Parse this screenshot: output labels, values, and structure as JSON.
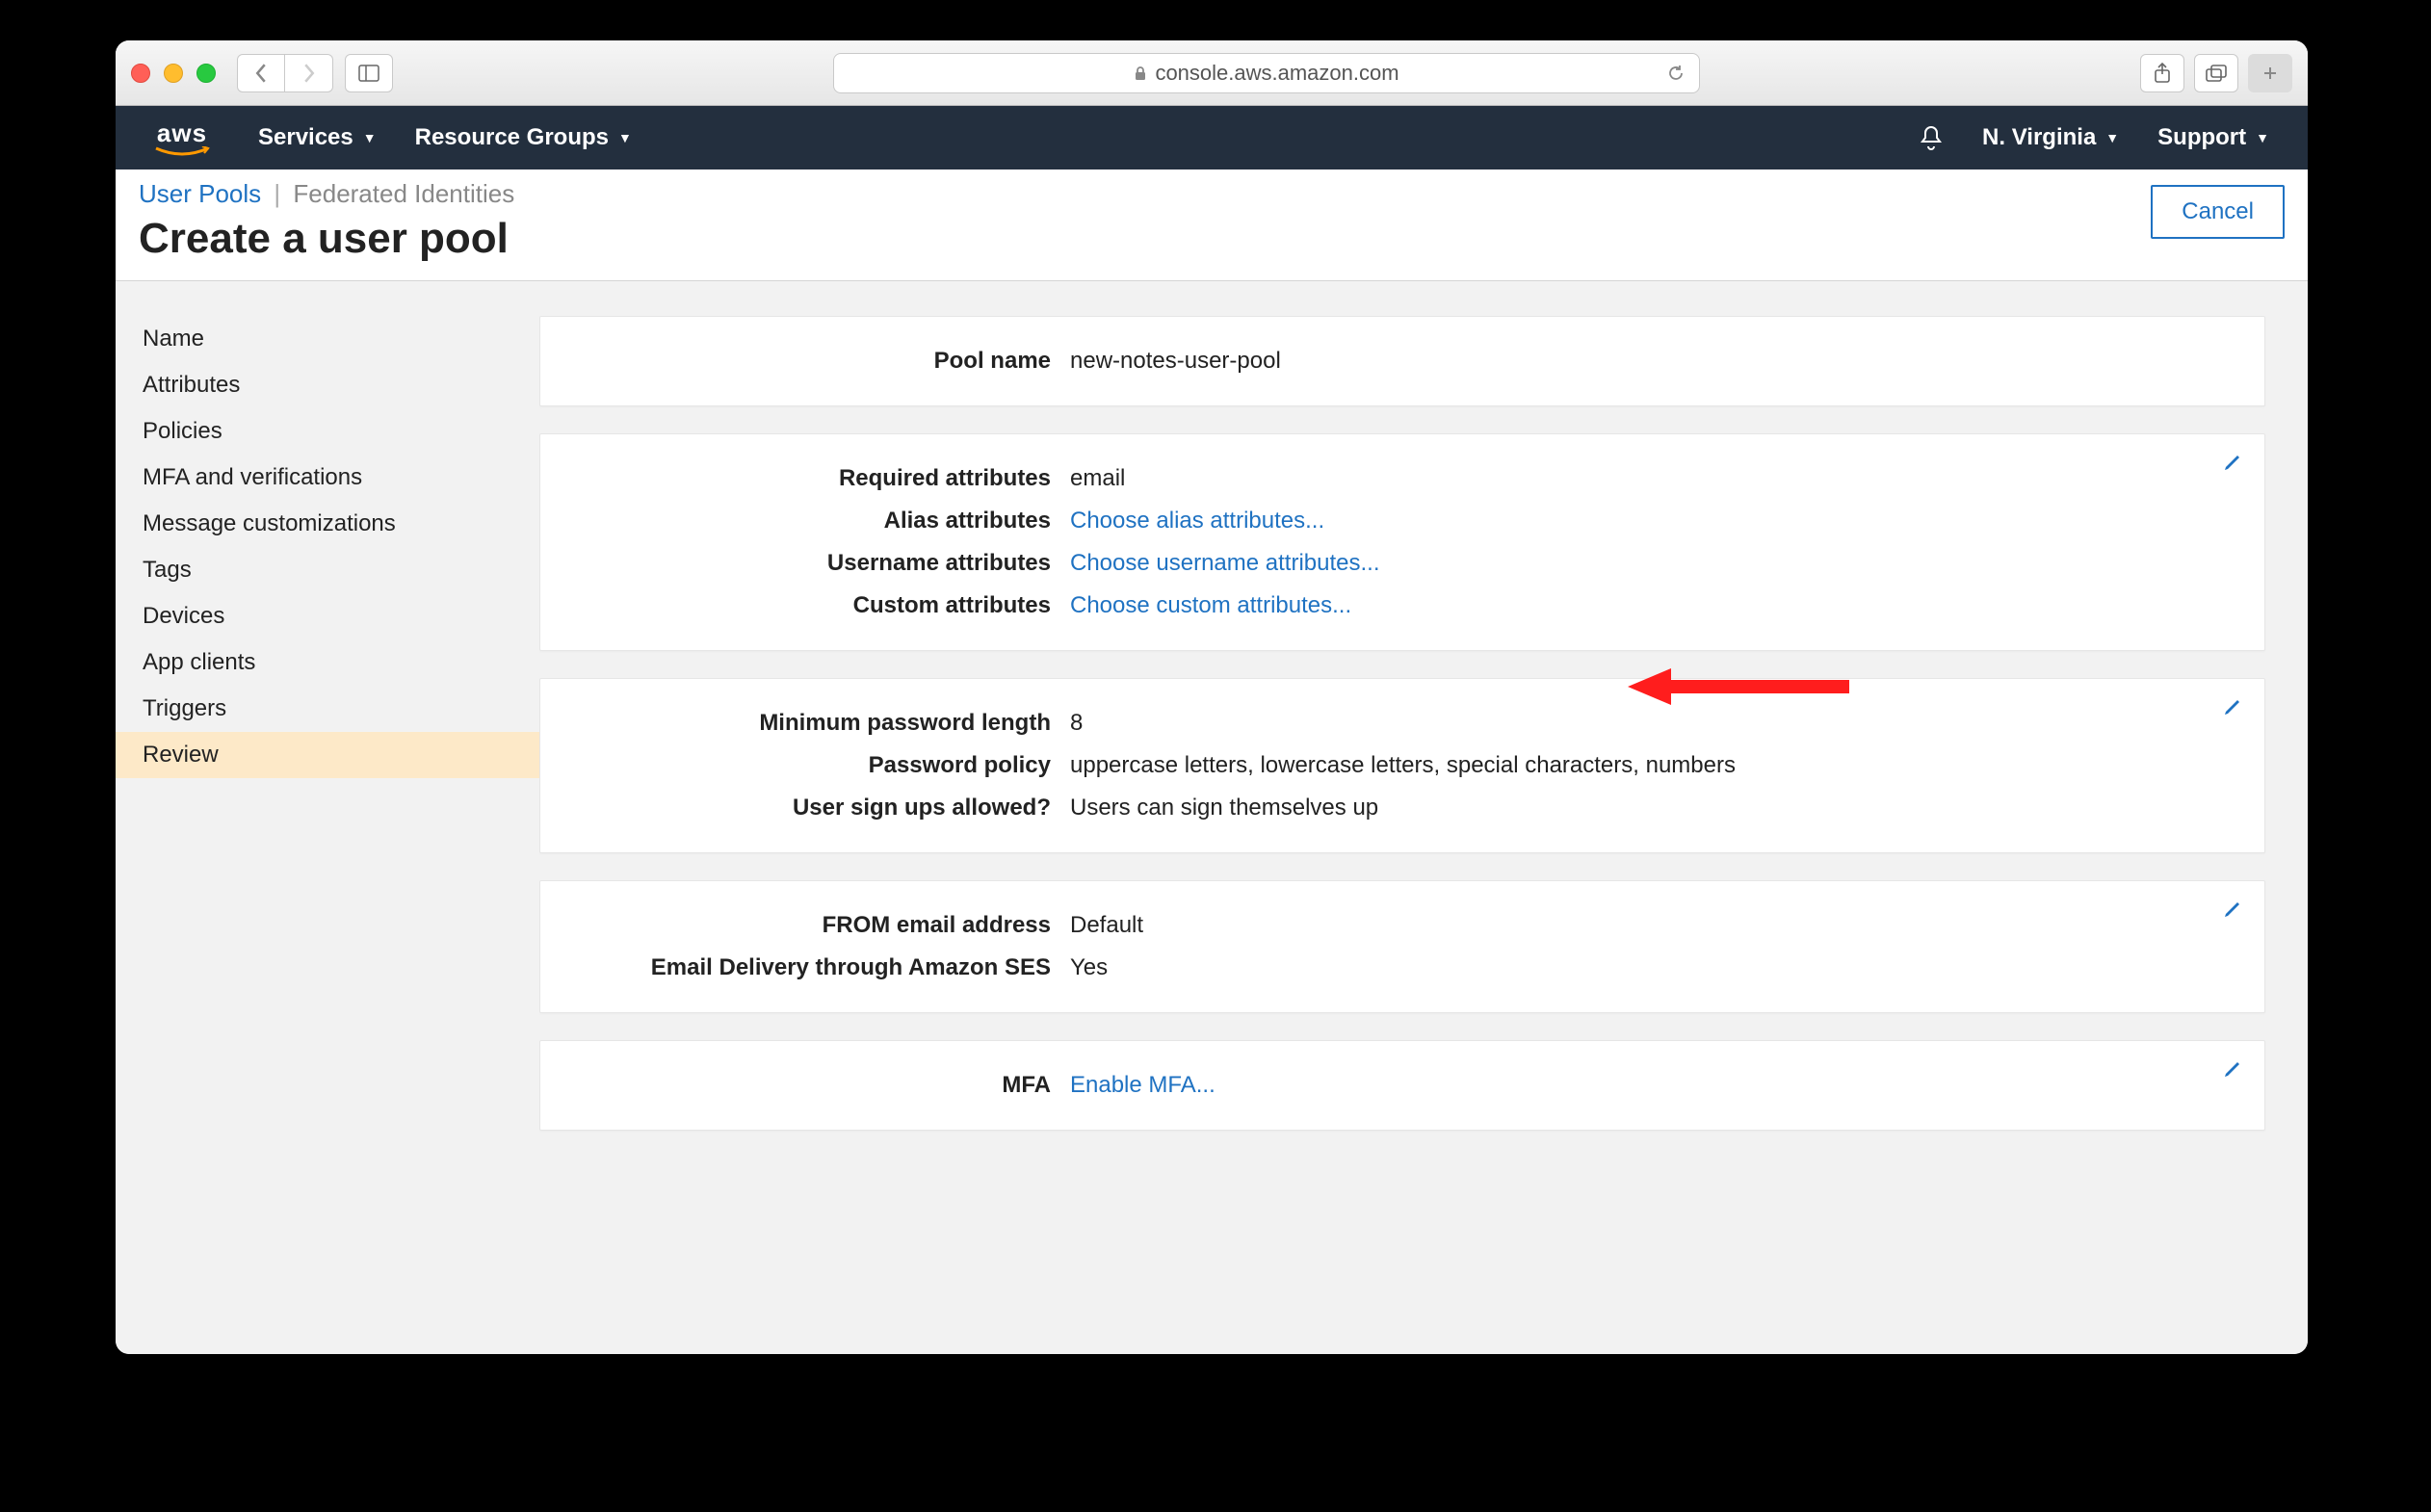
{
  "browser": {
    "url": "console.aws.amazon.com"
  },
  "nav": {
    "services": "Services",
    "resource_groups": "Resource Groups",
    "region": "N. Virginia",
    "support": "Support"
  },
  "subheader": {
    "tab_userpools": "User Pools",
    "tab_federated": "Federated Identities",
    "title": "Create a user pool",
    "cancel": "Cancel"
  },
  "sidebar": {
    "items": [
      "Name",
      "Attributes",
      "Policies",
      "MFA and verifications",
      "Message customizations",
      "Tags",
      "Devices",
      "App clients",
      "Triggers",
      "Review"
    ],
    "active_index": 9
  },
  "cards": {
    "name": {
      "pool_name_label": "Pool name",
      "pool_name_value": "new-notes-user-pool"
    },
    "attrs": {
      "required_label": "Required attributes",
      "required_value": "email",
      "alias_label": "Alias attributes",
      "alias_link": "Choose alias attributes...",
      "username_label": "Username attributes",
      "username_link": "Choose username attributes...",
      "custom_label": "Custom attributes",
      "custom_link": "Choose custom attributes..."
    },
    "policies": {
      "minlen_label": "Minimum password length",
      "minlen_value": "8",
      "policy_label": "Password policy",
      "policy_value": "uppercase letters, lowercase letters, special characters, numbers",
      "signup_label": "User sign ups allowed?",
      "signup_value": "Users can sign themselves up"
    },
    "email": {
      "from_label": "FROM email address",
      "from_value": "Default",
      "ses_label": "Email Delivery through Amazon SES",
      "ses_value": "Yes"
    },
    "mfa": {
      "mfa_label": "MFA",
      "mfa_link": "Enable MFA..."
    }
  }
}
